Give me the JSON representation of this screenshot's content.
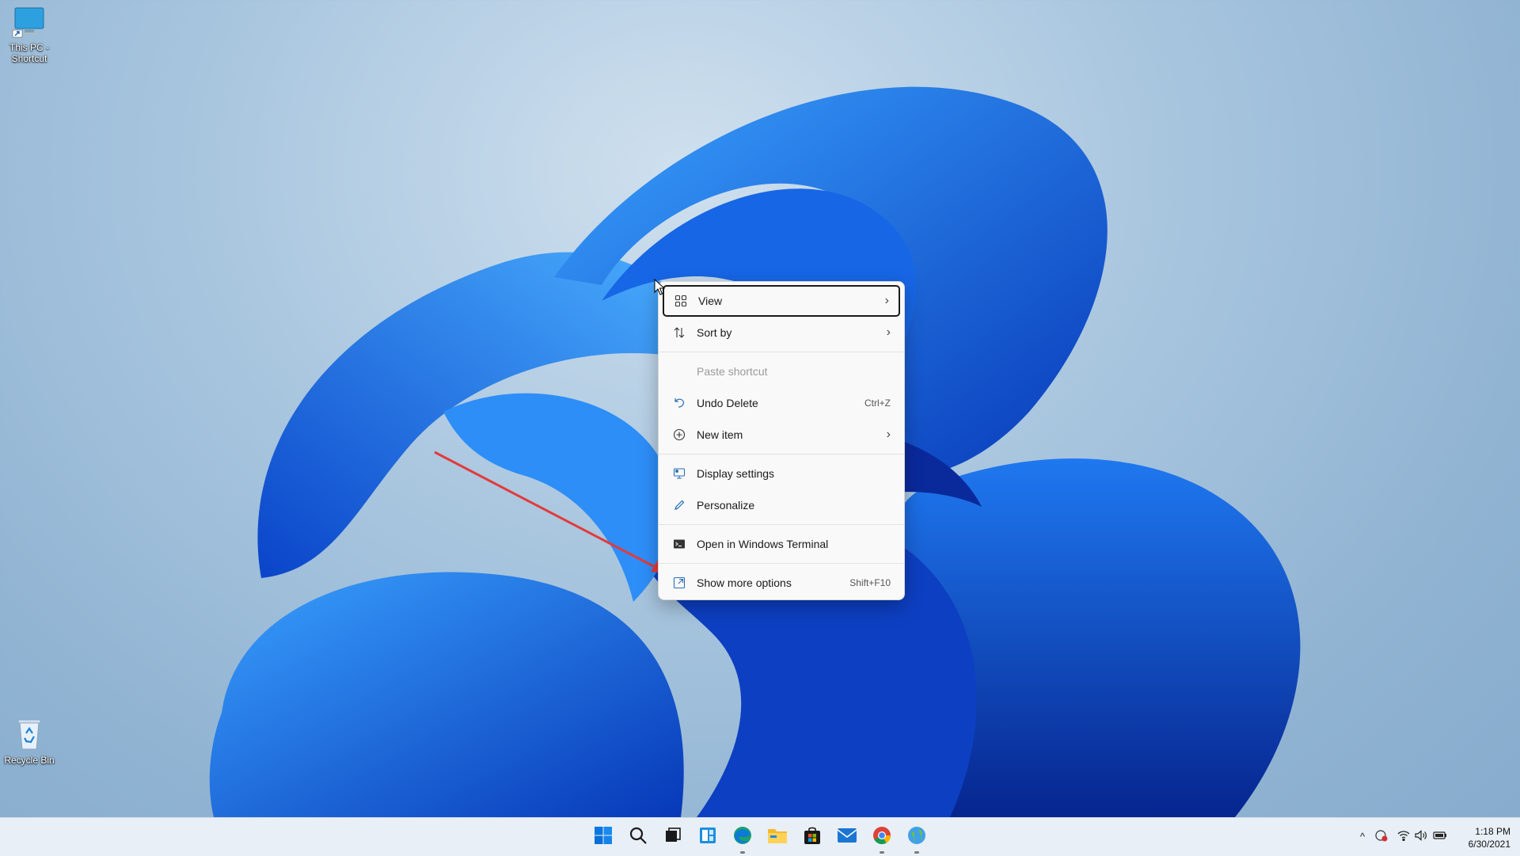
{
  "desktop": {
    "icons": [
      {
        "label_line1": "This PC -",
        "label_line2": "Shortcut",
        "icon": "monitor-shortcut-icon"
      },
      {
        "label": "Recycle Bin",
        "icon": "recycle-bin-icon"
      }
    ]
  },
  "context_menu": {
    "items": [
      {
        "label": "View",
        "icon": "grid-view-icon",
        "submenu": true
      },
      {
        "label": "Sort by",
        "icon": "sort-arrows-icon",
        "submenu": true
      },
      {
        "label": "Paste shortcut",
        "disabled": true
      },
      {
        "label": "Undo Delete",
        "icon": "undo-icon",
        "shortcut": "Ctrl+Z"
      },
      {
        "label": "New item",
        "icon": "plus-circle-icon",
        "submenu": true
      },
      {
        "label": "Display settings",
        "icon": "display-settings-icon"
      },
      {
        "label": "Personalize",
        "icon": "pen-icon"
      },
      {
        "label": "Open in Windows Terminal",
        "icon": "terminal-icon"
      },
      {
        "label": "Show more options",
        "icon": "more-options-icon",
        "shortcut": "Shift+F10"
      }
    ],
    "chevron": "›"
  },
  "taskbar": {
    "apps": [
      "start-icon",
      "search-icon",
      "task-view-icon",
      "widgets-icon",
      "edge-icon",
      "file-explorer-icon",
      "store-icon",
      "mail-icon",
      "chrome-icon",
      "globe-app-icon"
    ],
    "tray_icons": [
      "chevron-up-icon",
      "security-alert-icon",
      "wifi-icon",
      "volume-icon",
      "battery-icon"
    ],
    "tray_chevron": "^",
    "clock": {
      "time": "1:18 PM",
      "date": "6/30/2021"
    }
  },
  "colors": {
    "accent": "#0a5bd6",
    "arrow": "#e23b3b"
  }
}
